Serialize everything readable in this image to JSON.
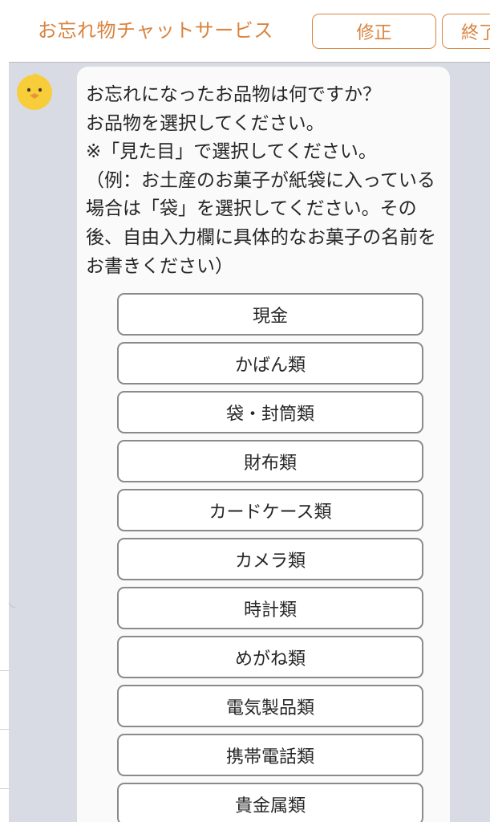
{
  "header": {
    "title": "お忘れ物チャットサービス",
    "edit_label": "修正",
    "end_label": "終了"
  },
  "message": {
    "text": "お忘れになったお品物は何ですか？\nお品物を選択してください。\n※「見た目」で選択してください。\n（例：お土産のお菓子が紙袋に入っている場合は「袋」を選択してください。その後、自由入力欄に具体的なお菓子の名前をお書きください）"
  },
  "options": [
    {
      "label": "現金"
    },
    {
      "label": "かばん類"
    },
    {
      "label": "袋・封筒類"
    },
    {
      "label": "財布類"
    },
    {
      "label": "カードケース類"
    },
    {
      "label": "カメラ類"
    },
    {
      "label": "時計類"
    },
    {
      "label": "めがね類"
    },
    {
      "label": "電気製品類"
    },
    {
      "label": "携帯電話類"
    },
    {
      "label": "貴金属類"
    }
  ],
  "colors": {
    "accent": "#d9843f",
    "chat_background": "#d8dbe4",
    "bubble": "#fafafa",
    "option_border": "#8a8a8a",
    "avatar": "#f7cd3a"
  },
  "icons": {
    "avatar": "chick-avatar-icon"
  }
}
